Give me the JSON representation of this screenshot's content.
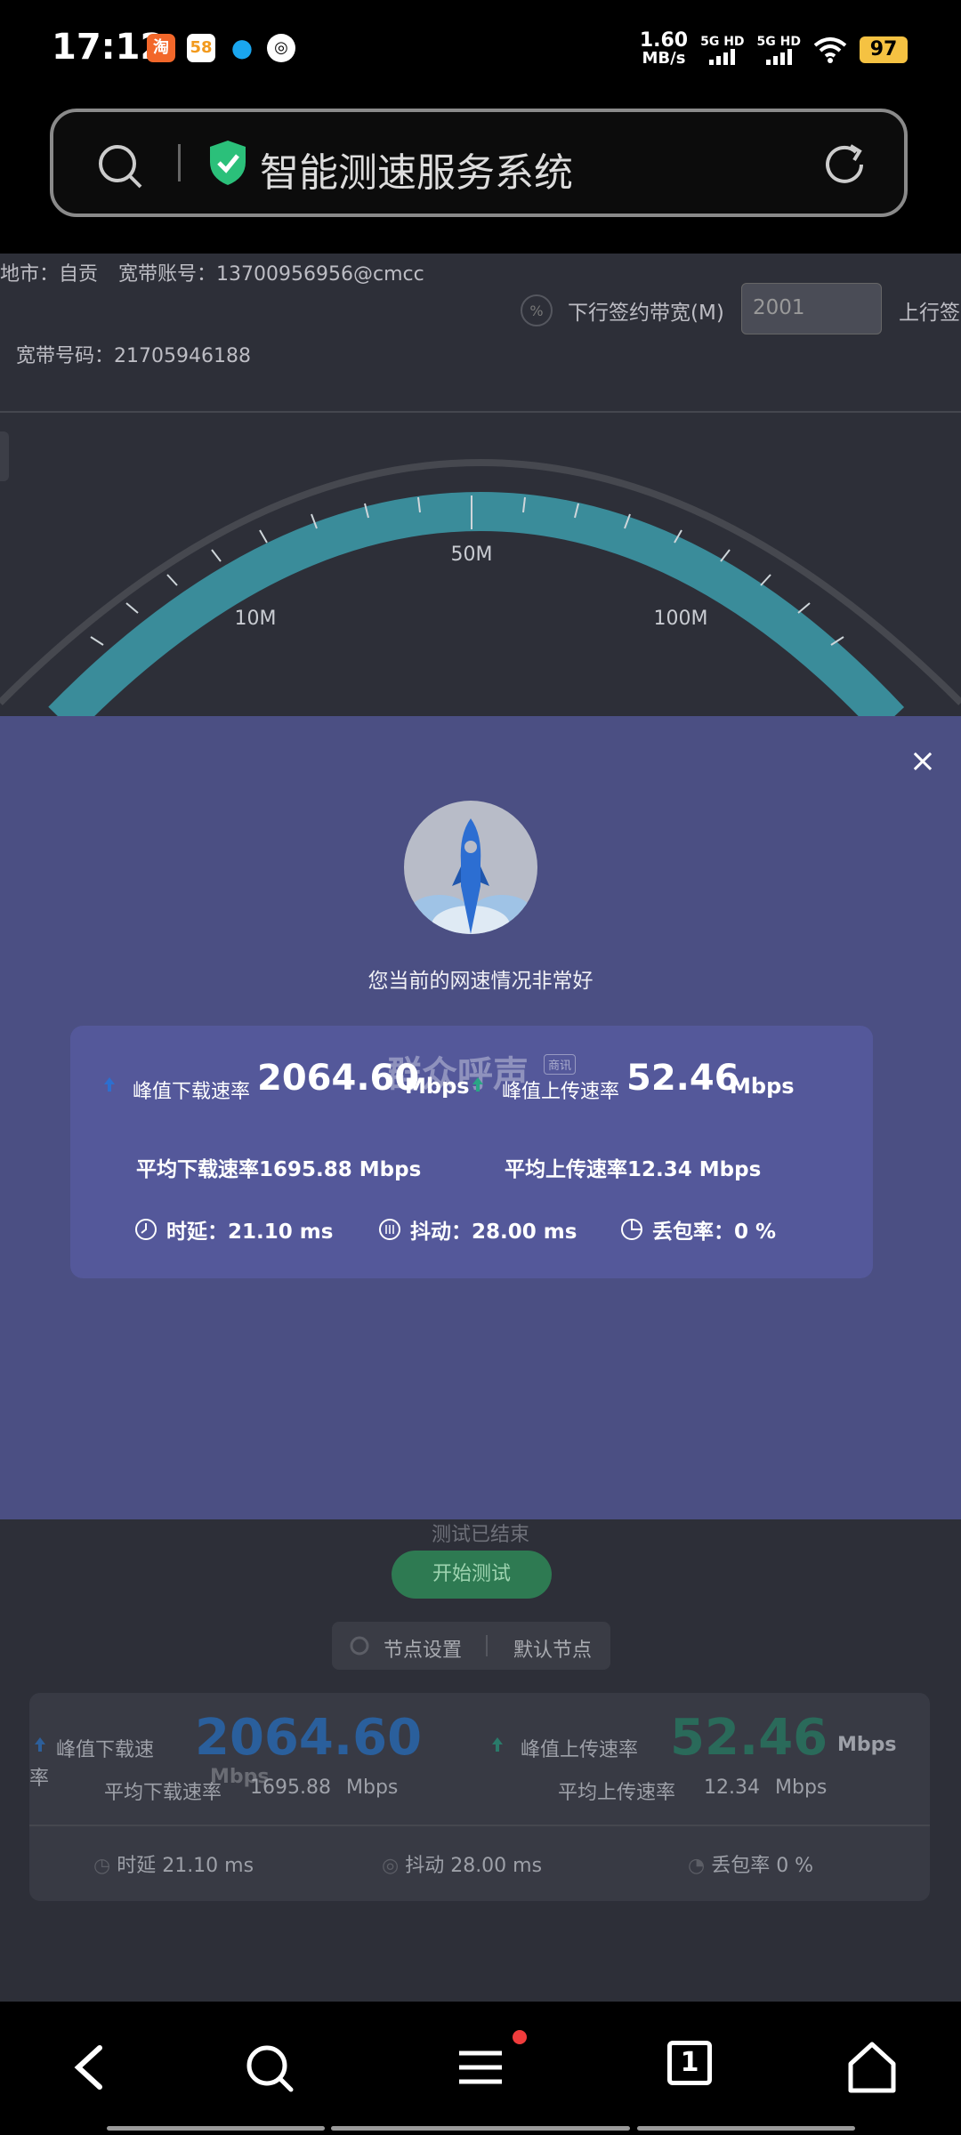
{
  "status_bar": {
    "time": "17:12",
    "net_speed_value": "1.60",
    "net_speed_unit": "MB/s",
    "sim1_label": "5G HD",
    "sim2_label": "5G HD",
    "battery": "97",
    "app_icons": [
      "taobao-icon",
      "58-icon",
      "qq-icon",
      "camera-app-icon"
    ]
  },
  "url_bar": {
    "title": "智能测速服务系统"
  },
  "info": {
    "city": "地市：自贡",
    "account": "宽带账号：13700956956@cmcc",
    "broadband_no": "宽带号码：21705946188",
    "down_label": "下行签约带宽(M)",
    "down_value": "2001",
    "up_label": "上行签"
  },
  "gauge": {
    "labels": [
      "10M",
      "50M",
      "100M"
    ]
  },
  "modal": {
    "status_message": "您当前的网速情况非常好",
    "peak_down_label": "峰值下载速率",
    "peak_down_value": "2064.60",
    "peak_down_unit": "Mbps",
    "peak_up_label": "峰值上传速率",
    "peak_up_value": "52.46",
    "peak_up_unit": "Mbps",
    "avg_down": "平均下载速率1695.88 Mbps",
    "avg_up": "平均上传速率12.34 Mbps",
    "latency": "时延：21.10 ms",
    "jitter": "抖动：28.00 ms",
    "loss": "丢包率：0 %",
    "watermark": "群众呼声",
    "watermark_badge": "商讯",
    "close": "×"
  },
  "below": {
    "test_done": "测试已结束",
    "start_button": "开始测试",
    "node_settings": "节点设置",
    "default_node": "默认节点",
    "peak_down_label_a": "峰值下载速",
    "peak_down_label_b": "率",
    "peak_down_value": "2064.60",
    "peak_down_unit": "Mbps",
    "peak_up_label": "峰值上传速率",
    "peak_up_value": "52.46",
    "peak_up_unit": "Mbps",
    "avg_down_label": "平均下载速率",
    "avg_down_value": "1695.88",
    "avg_down_unit": "Mbps",
    "avg_up_label": "平均上传速率",
    "avg_up_value": "12.34",
    "avg_up_unit": "Mbps",
    "latency": "时延  21.10 ms",
    "jitter": "抖动  28.00 ms",
    "loss": "丢包率  0 %"
  },
  "nav": {
    "tabs_count": "1"
  },
  "colors": {
    "modal_bg": "#4b4f83",
    "gauge_teal": "#3a8c9a",
    "start_green": "#2e7a52"
  }
}
